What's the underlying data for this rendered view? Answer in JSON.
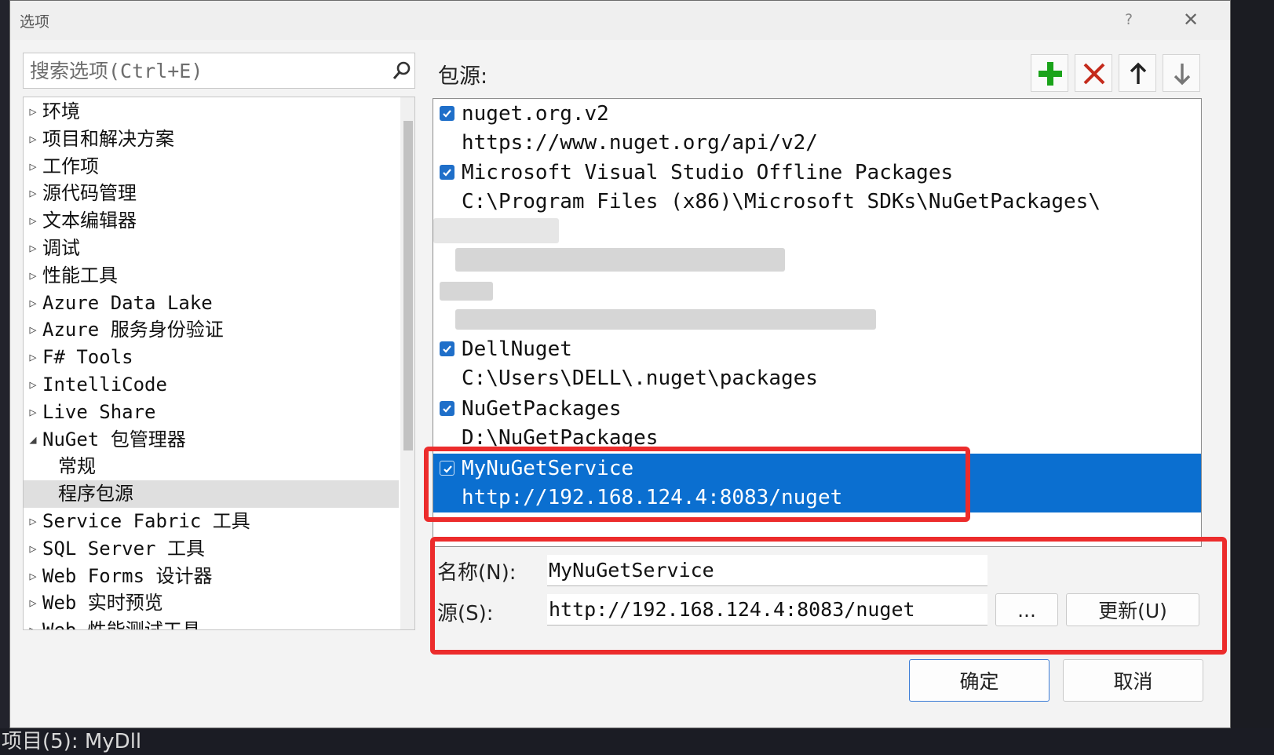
{
  "dialog": {
    "title": "选项",
    "help": "?",
    "close": "✕"
  },
  "search": {
    "placeholder": "搜索选项(Ctrl+E)"
  },
  "tree": {
    "items": [
      {
        "arrow": "▷",
        "label": "环境"
      },
      {
        "arrow": "▷",
        "label": "项目和解决方案"
      },
      {
        "arrow": "▷",
        "label": "工作项"
      },
      {
        "arrow": "▷",
        "label": "源代码管理"
      },
      {
        "arrow": "▷",
        "label": "文本编辑器"
      },
      {
        "arrow": "▷",
        "label": "调试"
      },
      {
        "arrow": "▷",
        "label": "性能工具"
      },
      {
        "arrow": "▷",
        "label": "Azure Data Lake"
      },
      {
        "arrow": "▷",
        "label": "Azure 服务身份验证"
      },
      {
        "arrow": "▷",
        "label": "F# Tools"
      },
      {
        "arrow": "▷",
        "label": "IntelliCode"
      },
      {
        "arrow": "▷",
        "label": "Live Share"
      },
      {
        "arrow": "◢",
        "label": "NuGet 包管理器"
      },
      {
        "arrow": "",
        "label": "常规"
      },
      {
        "arrow": "",
        "label": "程序包源"
      },
      {
        "arrow": "▷",
        "label": "Service Fabric 工具"
      },
      {
        "arrow": "▷",
        "label": "SQL Server 工具"
      },
      {
        "arrow": "▷",
        "label": "Web Forms 设计器"
      },
      {
        "arrow": "▷",
        "label": "Web 实时预览"
      },
      {
        "arrow": "▷",
        "label": "Web 性能测试工具"
      }
    ]
  },
  "sources_label": "包源:",
  "sources": [
    {
      "name": "nuget.org.v2",
      "url": "https://www.nuget.org/api/v2/",
      "checked": true
    },
    {
      "name": "Microsoft Visual Studio Offline Packages",
      "url": "C:\\Program Files (x86)\\Microsoft SDKs\\NuGetPackages\\",
      "checked": true
    },
    {
      "name": "DellNuget",
      "url": "C:\\Users\\DELL\\.nuget\\packages",
      "checked": true
    },
    {
      "name": "NuGetPackages",
      "url": "D:\\NuGetPackages",
      "checked": true
    },
    {
      "name": "MyNuGetService",
      "url": "http://192.168.124.4:8083/nuget",
      "checked": true
    }
  ],
  "form": {
    "name_label": "名称(N):",
    "name_value": "MyNuGetService",
    "source_label": "源(S):",
    "source_value": "http://192.168.124.4:8083/nuget",
    "browse_label": "...",
    "update_label": "更新(U)"
  },
  "buttons": {
    "ok": "确定",
    "cancel": "取消"
  },
  "background": {
    "bottom_text": "项目(5): MyDll"
  },
  "colors": {
    "selection": "#0b6fd0",
    "highlight": "#ec2c2c",
    "add": "#1aa31a",
    "remove": "#c42b1c"
  }
}
